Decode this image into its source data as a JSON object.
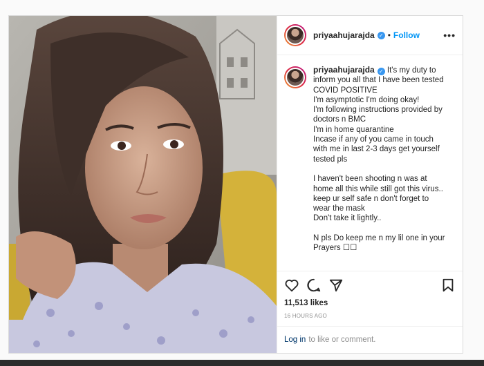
{
  "post": {
    "username": "priyaahujarajda",
    "verified_glyph": "✓",
    "dot": "•",
    "follow_label": "Follow",
    "more_label": "•••",
    "caption": "It's my duty to inform you all that I have been tested COVID POSITIVE\nI'm asymptotic I'm doing okay!\nI'm following instructions provided by doctors n BMC\nI'm in home quarantine\nIncase if any of you came in touch with me in last 2-3 days get yourself tested pls\n\nI haven't been shooting n was at home all this while still got this virus.. keep ur self safe n don't forget to wear the mask\nDon't take it lightly..\n\nN pls Do keep me n my lil one in your Prayers ☐☐",
    "likes": "11,513 likes",
    "time": "16 HOURS AGO",
    "login_link": "Log in",
    "login_text": "to like or comment."
  },
  "icons": {
    "like": "heart-icon",
    "comment": "comment-icon",
    "share": "paper-plane-icon",
    "save": "bookmark-icon"
  },
  "colors": {
    "link": "#0095f6",
    "verified": "#3897f0",
    "muted": "#8e8e8e"
  }
}
